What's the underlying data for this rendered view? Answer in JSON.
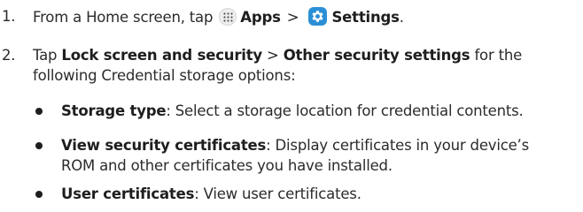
{
  "step1": {
    "number": "1.",
    "prefix": "From a Home screen, tap",
    "apps_label": "Apps",
    "separator": ">",
    "settings_label": "Settings",
    "suffix": ".",
    "apps_icon": "apps-grid-icon",
    "settings_icon": "gear-icon"
  },
  "step2": {
    "number": "2.",
    "tap": "Tap",
    "lock_label": "Lock screen and security",
    "separator": ">",
    "other_label": "Other security settings",
    "rest_line1": "for the",
    "line2": "following Credential storage options:"
  },
  "bullets": [
    {
      "term": "Storage type",
      "desc_line1": ": Select a storage location for credential contents."
    },
    {
      "term": "View security certificates",
      "desc_line1": ": Display certificates in your device’s",
      "desc_line2": "ROM and other certificates you have installed."
    },
    {
      "term": "User certificates",
      "desc_line1": ": View user certificates."
    }
  ]
}
